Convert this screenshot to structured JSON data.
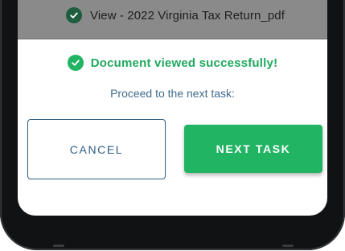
{
  "background_dialog": {
    "item_label": "View - 2022 Virginia Tax Return_pdf",
    "icon": "check-circle-icon"
  },
  "dialog": {
    "success_message": "Document viewed successfully!",
    "success_icon": "check-circle-icon",
    "instruction": "Proceed to the next task:",
    "cancel_label": "CANCEL",
    "next_label": "NEXT TASK"
  },
  "colors": {
    "success_green": "#21b463",
    "primary_blue": "#2f5e86",
    "overlay_gray": "#8a8a8a"
  }
}
